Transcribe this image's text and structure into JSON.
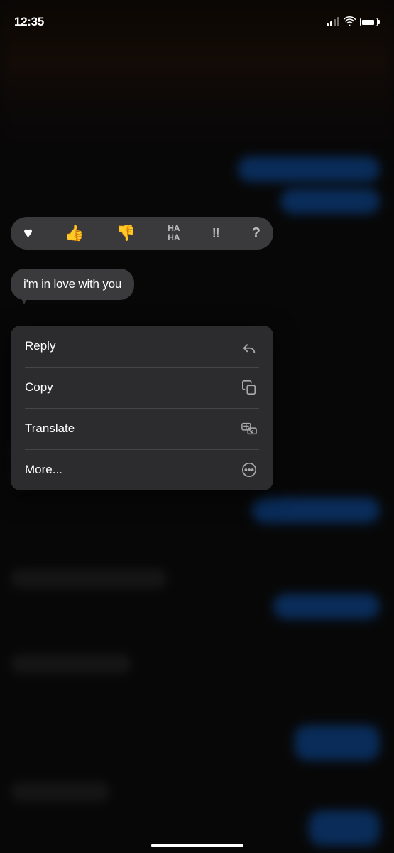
{
  "statusBar": {
    "time": "12:35"
  },
  "reactionBar": {
    "reactions": [
      {
        "id": "heart",
        "emoji": "♥",
        "label": "Heart"
      },
      {
        "id": "thumbsup",
        "emoji": "👍",
        "label": "Like"
      },
      {
        "id": "thumbsdown",
        "emoji": "👎",
        "label": "Dislike"
      },
      {
        "id": "haha",
        "text": "HA\nHA",
        "label": "Haha"
      },
      {
        "id": "exclaim",
        "emoji": "‼",
        "label": "Emphasize"
      },
      {
        "id": "question",
        "emoji": "?",
        "label": "Question"
      }
    ]
  },
  "messageBubble": {
    "text": "i'm in love with you"
  },
  "contextMenu": {
    "items": [
      {
        "id": "reply",
        "label": "Reply",
        "icon": "reply"
      },
      {
        "id": "copy",
        "label": "Copy",
        "icon": "copy"
      },
      {
        "id": "translate",
        "label": "Translate",
        "icon": "translate"
      },
      {
        "id": "more",
        "label": "More...",
        "icon": "more"
      }
    ]
  },
  "homeIndicator": {}
}
